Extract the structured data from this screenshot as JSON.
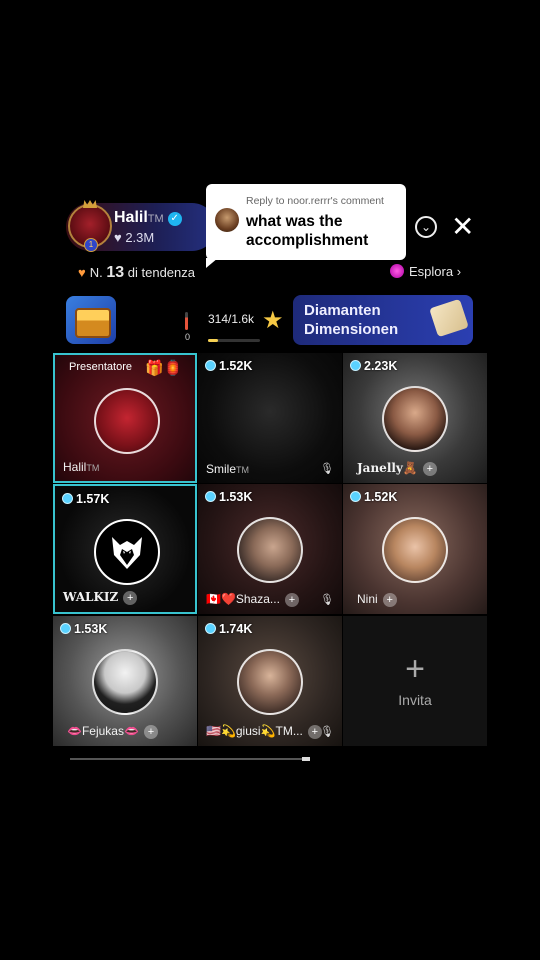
{
  "host": {
    "name": "Halil",
    "tm": "TM",
    "likes": "♥ 2.3M",
    "level_badge": "1"
  },
  "comment": {
    "reply_to": "Reply to noor.rerrr's comment",
    "text": "what was the accomplishment"
  },
  "controls": {
    "collapse_icon": "chevron-down-circle-icon",
    "close_icon": "close-icon"
  },
  "trending": {
    "prefix": "N.",
    "rank": "13",
    "suffix": "di tendenza",
    "explore": "Esplora ›"
  },
  "event": {
    "meter_zero": "0",
    "progress": "314/1.6k",
    "progress_fraction": 0.196,
    "banner": "Diamanten Dimensionen"
  },
  "grid": {
    "presenter_label": "Presentatore",
    "cells": [
      {
        "count": "",
        "name": "Halil",
        "tm": "TM"
      },
      {
        "count": "1.52K",
        "name": "Smile",
        "tm": "TM"
      },
      {
        "count": "2.23K",
        "name": "Janelly🧸"
      },
      {
        "count": "1.57K",
        "name": "WALKIZ"
      },
      {
        "count": "1.53K",
        "name": "🇨🇦❤️Shaza..."
      },
      {
        "count": "1.52K",
        "name": "Nini"
      },
      {
        "count": "1.53K",
        "name": "👄Fejukas👄"
      },
      {
        "count": "1.74K",
        "name": "🇺🇸💫giusi💫TM..."
      }
    ],
    "invite_label": "Invita"
  },
  "colors": {
    "selected_border": "#38c3cf",
    "star": "#f6c945",
    "banner": "#2b3fb2"
  }
}
